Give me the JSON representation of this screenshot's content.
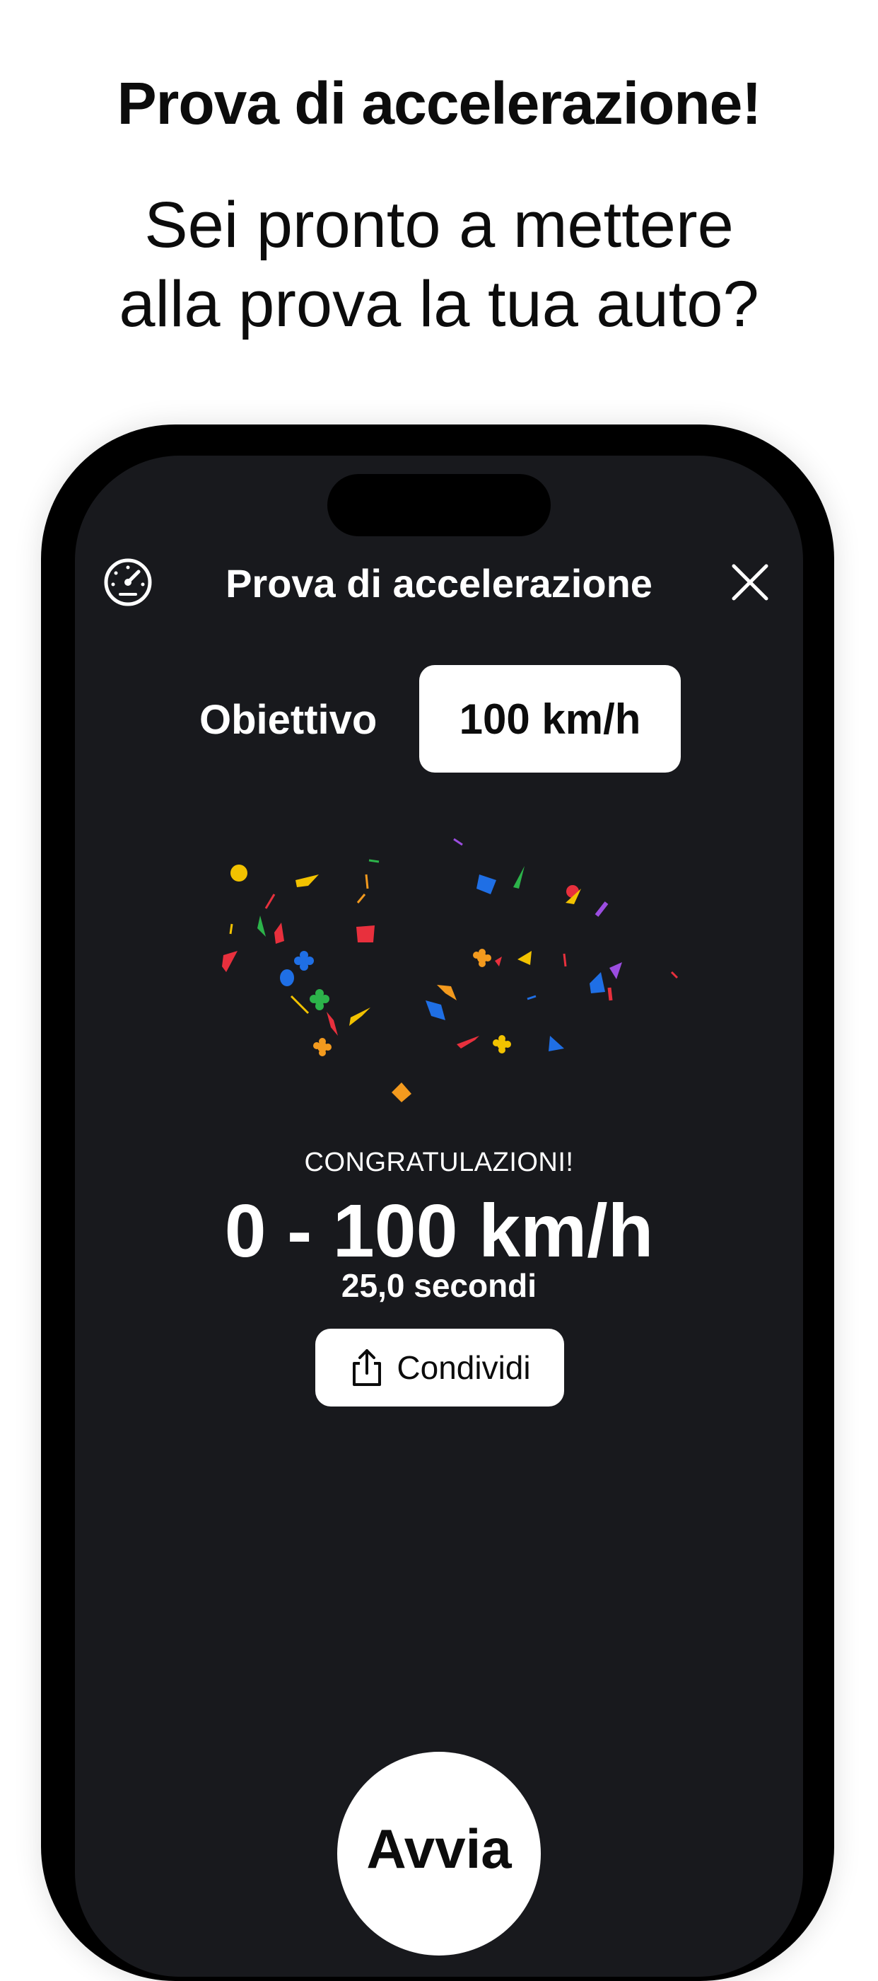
{
  "promo": {
    "title": "Prova di accelerazione!",
    "subtitle_line1": "Sei pronto a mettere",
    "subtitle_line2": "alla prova la tua auto?"
  },
  "app": {
    "header": {
      "title": "Prova di accelerazione",
      "left_icon": "speedometer-icon",
      "right_icon": "close-icon"
    },
    "goal": {
      "label": "Obiettivo",
      "selected_value": "100 km/h"
    },
    "result": {
      "congrats": "CONGRATULAZIONI!",
      "speed_range": "0 - 100 km/h",
      "time": "25,0 secondi"
    },
    "share_button": {
      "label": "Condividi",
      "icon": "share-icon"
    },
    "start_button": {
      "label": "Avvia"
    }
  },
  "colors": {
    "screen_background": "#18191d",
    "phone_frame": "#000000",
    "confetti": [
      "#f2c200",
      "#e8303d",
      "#1f6fe5",
      "#2cb34a",
      "#f39a1e",
      "#9b4de0"
    ]
  }
}
